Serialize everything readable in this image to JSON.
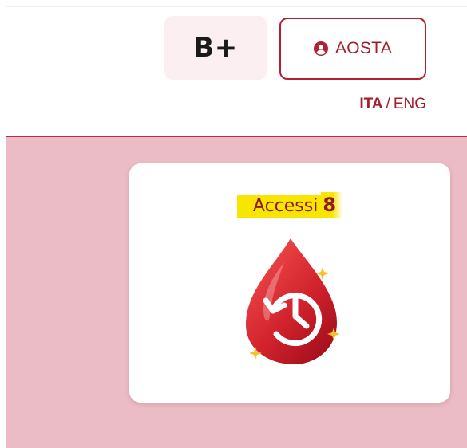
{
  "header": {
    "blood_type": "B+",
    "user_button": {
      "label": "AOSTA",
      "icon": "user-circle-icon"
    },
    "language": {
      "active": "ITA",
      "separator": "/",
      "inactive": "ENG"
    }
  },
  "card": {
    "title": "Accessi",
    "count": "8",
    "illustration_icon": "blood-drop-history-icon"
  },
  "colors": {
    "brand_red": "#a31d2e",
    "main_background": "#ebbcc5",
    "highlight": "#f8e600",
    "badge_background": "#fbeff1"
  }
}
